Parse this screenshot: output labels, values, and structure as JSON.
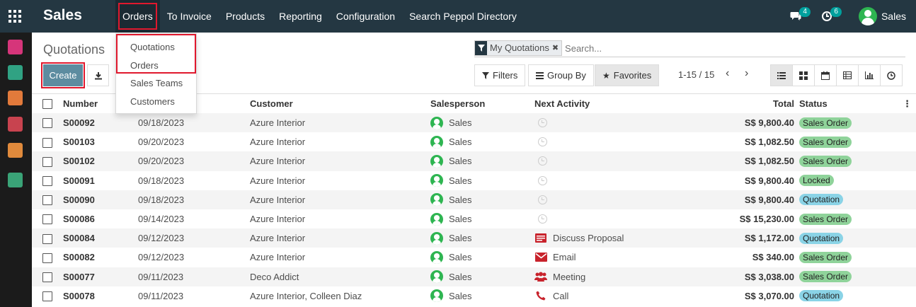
{
  "app": {
    "brand": "Sales"
  },
  "nav": [
    {
      "label": "Orders",
      "open": true
    },
    {
      "label": "To Invoice"
    },
    {
      "label": "Products"
    },
    {
      "label": "Reporting"
    },
    {
      "label": "Configuration"
    },
    {
      "label": "Search Peppol Directory"
    }
  ],
  "systray": {
    "messages_count": "4",
    "activities_count": "6",
    "user": "Sales"
  },
  "dropdown": [
    "Quotations",
    "Orders",
    "Sales Teams",
    "Customers"
  ],
  "control_panel": {
    "title": "Quotations",
    "create_label": "Create",
    "facet": "My Quotations",
    "search_placeholder": "Search...",
    "filters_label": "Filters",
    "groupby_label": "Group By",
    "favorites_label": "Favorites",
    "pager": "1-15 / 15"
  },
  "columns": [
    "Number",
    "Order Date",
    "Customer",
    "Salesperson",
    "Next Activity",
    "Total",
    "Status"
  ],
  "rows": [
    {
      "number": "S00092",
      "date": "09/18/2023",
      "customer": "Azure Interior",
      "salesperson": "Sales",
      "activity": "",
      "activity_type": "none",
      "total": "S$ 9,800.40",
      "status": "Sales Order"
    },
    {
      "number": "S00103",
      "date": "09/20/2023",
      "customer": "Azure Interior",
      "salesperson": "Sales",
      "activity": "",
      "activity_type": "none",
      "total": "S$ 1,082.50",
      "status": "Sales Order"
    },
    {
      "number": "S00102",
      "date": "09/20/2023",
      "customer": "Azure Interior",
      "salesperson": "Sales",
      "activity": "",
      "activity_type": "none",
      "total": "S$ 1,082.50",
      "status": "Sales Order"
    },
    {
      "number": "S00091",
      "date": "09/18/2023",
      "customer": "Azure Interior",
      "salesperson": "Sales",
      "activity": "",
      "activity_type": "none",
      "total": "S$ 9,800.40",
      "status": "Locked"
    },
    {
      "number": "S00090",
      "date": "09/18/2023",
      "customer": "Azure Interior",
      "salesperson": "Sales",
      "activity": "",
      "activity_type": "none",
      "total": "S$ 9,800.40",
      "status": "Quotation"
    },
    {
      "number": "S00086",
      "date": "09/14/2023",
      "customer": "Azure Interior",
      "salesperson": "Sales",
      "activity": "",
      "activity_type": "none",
      "total": "S$ 15,230.00",
      "status": "Sales Order"
    },
    {
      "number": "S00084",
      "date": "09/12/2023",
      "customer": "Azure Interior",
      "salesperson": "Sales",
      "activity": "Discuss Proposal",
      "activity_type": "proposal",
      "total": "S$ 1,172.00",
      "status": "Quotation"
    },
    {
      "number": "S00082",
      "date": "09/12/2023",
      "customer": "Azure Interior",
      "salesperson": "Sales",
      "activity": "Email",
      "activity_type": "email",
      "total": "S$ 340.00",
      "status": "Sales Order"
    },
    {
      "number": "S00077",
      "date": "09/11/2023",
      "customer": "Deco Addict",
      "salesperson": "Sales",
      "activity": "Meeting",
      "activity_type": "meeting",
      "total": "S$ 3,038.00",
      "status": "Sales Order"
    },
    {
      "number": "S00078",
      "date": "09/11/2023",
      "customer": "Azure Interior, Colleen Diaz",
      "salesperson": "Sales",
      "activity": "Call",
      "activity_type": "call",
      "total": "S$ 3,070.00",
      "status": "Quotation"
    }
  ],
  "colors": {
    "topbar": "#243742",
    "primary": "#5d8ca0",
    "highlight": "#e0182d",
    "sales_order": "#8fd39a",
    "quotation": "#8ad3e6",
    "locked": "#8fd39a",
    "activity_red": "#c8232c"
  }
}
